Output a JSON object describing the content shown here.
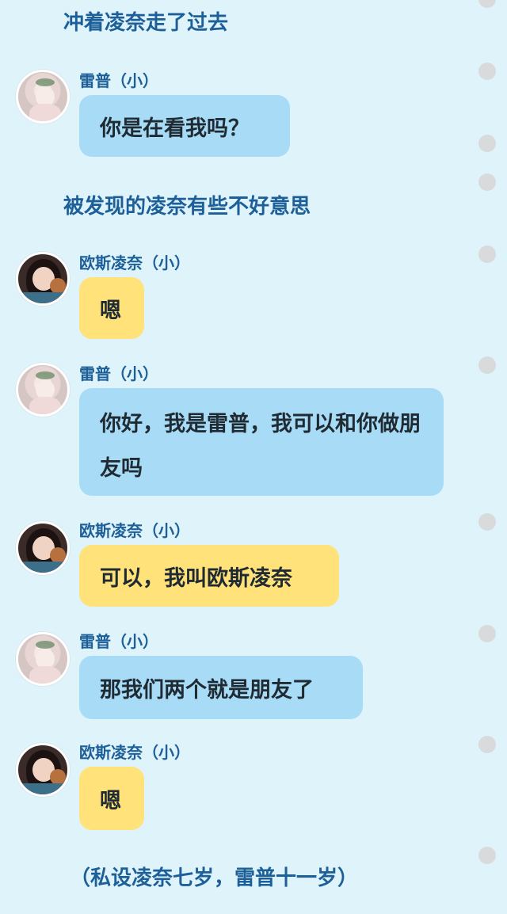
{
  "narration": [
    "冲着凌奈走了过去",
    "被发现的凌奈有些不好意思",
    "（私设凌奈七岁，雷普十一岁）"
  ],
  "messages": [
    {
      "speaker": "雷普（小）",
      "text": "你是在看我吗？"
    },
    {
      "speaker": "欧斯凌奈（小）",
      "text": "嗯"
    },
    {
      "speaker": "雷普（小）",
      "text": "你好，我是雷普，我可以和你做朋友吗"
    },
    {
      "speaker": "欧斯凌奈（小）",
      "text": "可以，我叫欧斯凌奈"
    },
    {
      "speaker": "雷普（小）",
      "text": "那我们两个就是朋友了"
    },
    {
      "speaker": "欧斯凌奈（小）",
      "text": "嗯"
    }
  ],
  "colors": {
    "background": "#dff3fb",
    "narration_text": "#1d5f98",
    "bubble_blue": "#a8dcf6",
    "bubble_yellow": "#ffe27a",
    "scroll_dot": "#d9dadb"
  }
}
